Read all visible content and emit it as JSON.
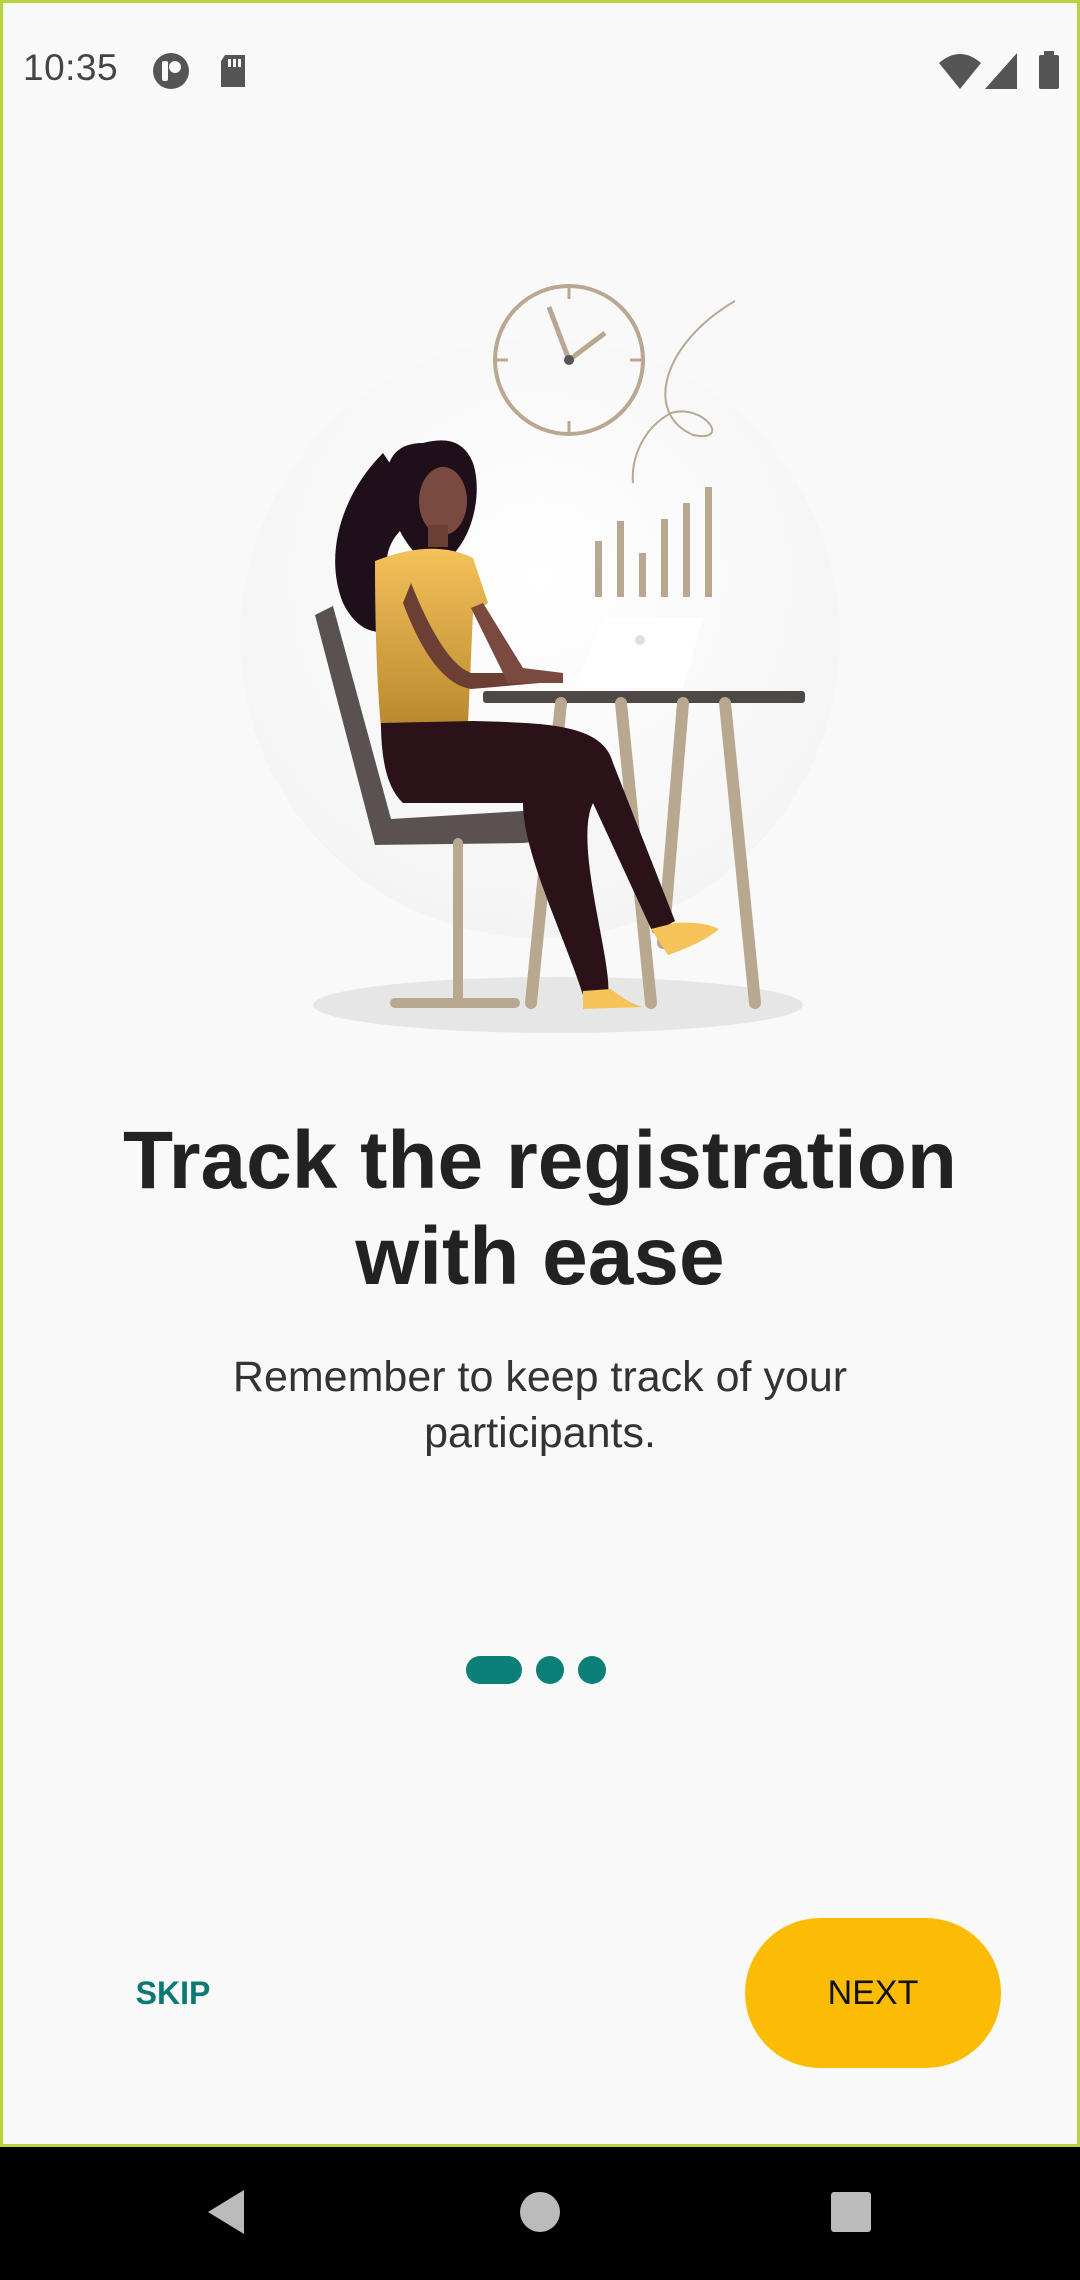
{
  "status_bar": {
    "time": "10:35",
    "left_icons": [
      "notification-app-icon",
      "sd-card-icon"
    ],
    "right_icons": [
      "wifi-icon",
      "signal-icon",
      "battery-icon"
    ]
  },
  "onboarding": {
    "illustration": "woman-at-laptop-illustration",
    "title_line1": "Track the registration",
    "title_line2": "with ease",
    "subtitle_line1": "Remember to keep track of your",
    "subtitle_line2": "participants.",
    "page_indicator": {
      "count": 3,
      "active_index": 0,
      "color": "#0a8078"
    }
  },
  "actions": {
    "skip_label": "SKIP",
    "next_label": "NEXT",
    "next_color": "#fcbc05",
    "skip_color": "#0a7a72"
  },
  "nav_bar": {
    "buttons": [
      "back-icon",
      "home-icon",
      "recents-icon"
    ]
  }
}
